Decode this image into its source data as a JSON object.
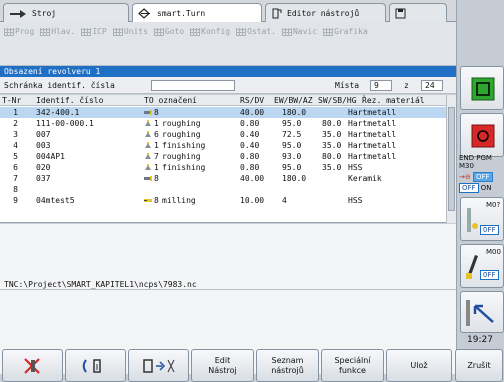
{
  "tabs": [
    {
      "label": "Stroj",
      "icon": "machine-icon"
    },
    {
      "label": "smart.Turn",
      "icon": "diamond-arrow-icon"
    },
    {
      "label": "Editor nástrojů",
      "icon": "tool-editor-icon"
    },
    {
      "label": "",
      "icon": "save-icon"
    }
  ],
  "menus": [
    "Prog",
    "Hlav.",
    "ICP",
    "Units",
    "Goto",
    "Konfig",
    "Ostat.",
    "Navic",
    "Grafika"
  ],
  "window_title": "Obsazení revolveru 1",
  "clipboard": {
    "label": "Schránka identif. čísla",
    "value": "",
    "mista_label": "Místa",
    "mista_value": "9",
    "z_label": "z",
    "total": "24"
  },
  "table": {
    "columns": [
      "T-Nr",
      "Identif. číslo",
      "TO označení",
      "RS/DV",
      "EW/BW/AZ",
      "SW/SB/HG",
      "Řez. materiál"
    ],
    "rows": [
      {
        "t": "1",
        "id": "342-400.1",
        "to": "8",
        "desc": "",
        "rs": "40.00",
        "ew": "180.0",
        "sw": "",
        "mat": "Hartmetall",
        "icon": "boring-tool-icon",
        "sel": true
      },
      {
        "t": "2",
        "id": "111-00-000.1",
        "to": "1",
        "desc": "roughing",
        "rs": "0.80",
        "ew": "95.0",
        "sw": "80.0",
        "mat": "Hartmetall",
        "icon": "turning-tool-icon",
        "sel": false
      },
      {
        "t": "3",
        "id": "007",
        "to": "6",
        "desc": "roughing",
        "rs": "0.40",
        "ew": "72.5",
        "sw": "35.0",
        "mat": "Hartmetall",
        "icon": "turning-tool-icon",
        "sel": false
      },
      {
        "t": "4",
        "id": "003",
        "to": "1",
        "desc": "finishing",
        "rs": "0.40",
        "ew": "95.0",
        "sw": "35.0",
        "mat": "Hartmetall",
        "icon": "turning-tool-icon",
        "sel": false
      },
      {
        "t": "5",
        "id": "004AP1",
        "to": "7",
        "desc": "roughing",
        "rs": "0.80",
        "ew": "93.0",
        "sw": "80.0",
        "mat": "Hartmetall",
        "icon": "turning-tool-icon",
        "sel": false
      },
      {
        "t": "6",
        "id": "020",
        "to": "1",
        "desc": "finishing",
        "rs": "0.80",
        "ew": "95.0",
        "sw": "35.0",
        "mat": "HSS",
        "icon": "turning-tool-icon",
        "sel": false
      },
      {
        "t": "7",
        "id": "037",
        "to": "8",
        "desc": "",
        "rs": "40.00",
        "ew": "180.0",
        "sw": "",
        "mat": "Keramik",
        "icon": "boring-tool-icon",
        "sel": false
      },
      {
        "t": "8",
        "id": "",
        "to": "",
        "desc": "",
        "rs": "",
        "ew": "",
        "sw": "",
        "mat": "",
        "icon": "",
        "sel": false
      },
      {
        "t": "9",
        "id": "04mtest5",
        "to": "8",
        "desc": "milling",
        "rs": "10.00",
        "ew": "4",
        "sw": "",
        "mat": "HSS",
        "icon": "milling-tool-icon",
        "sel": false
      }
    ]
  },
  "path": "TNC:\\Project\\SMART_KAPITEL1\\ncps\\7983.nc",
  "softkeys": [
    {
      "label": "",
      "icon": "delete-tool-icon"
    },
    {
      "label": "",
      "icon": "tool-transfer-icon"
    },
    {
      "label": "",
      "icon": "tool-swap-icon"
    },
    {
      "label": "Edit\nNástroj",
      "icon": ""
    },
    {
      "label": "Seznam\nnástrojů",
      "icon": ""
    },
    {
      "label": "Speciální\nfunkce",
      "icon": ""
    },
    {
      "label": "Ulož",
      "icon": ""
    },
    {
      "label": "Zrušit",
      "icon": ""
    }
  ],
  "side": {
    "end_pgm": "END PGM M30",
    "off1": "OFF",
    "on1": "ON",
    "m_label1": "M0?",
    "off2": "OFF",
    "m_label2": "M00",
    "off3": "OFF",
    "clock": "19:27"
  },
  "colors": {
    "titlebar": "#1f6fc5",
    "selected_row": "#bcd7f2",
    "green_key": "#2fa62f",
    "red_key": "#d62828"
  }
}
